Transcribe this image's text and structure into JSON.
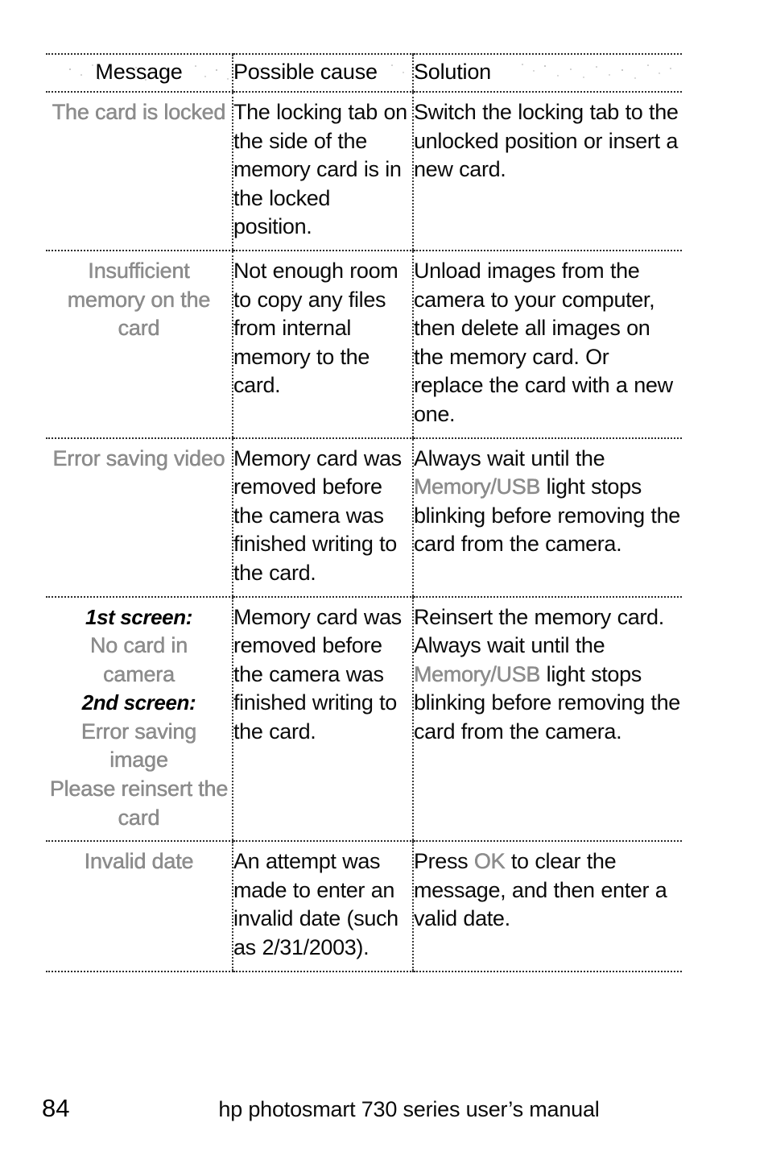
{
  "page": {
    "number": "84",
    "running_head": "hp photosmart 730 series user’s manual"
  },
  "table": {
    "headers": {
      "message": "Message",
      "possible_cause": "Possible cause",
      "solution": "Solution"
    },
    "rows": [
      {
        "message_lines": [
          "The card is locked"
        ],
        "possible_cause": "The locking tab on the side of the memory card is in the locked position.",
        "solution_pre": "Switch the locking tab to the unlocked position or insert a new card.",
        "solution_screen": "",
        "solution_post": ""
      },
      {
        "message_lines": [
          "Insufficient",
          "memory on the",
          "card"
        ],
        "possible_cause": "Not enough room to copy any files from internal memory to the card.",
        "solution_pre": "Unload images from the camera to your computer, then delete all images on the memory card. Or replace the card with a new one.",
        "solution_screen": "",
        "solution_post": ""
      },
      {
        "message_lines": [
          "Error saving video"
        ],
        "possible_cause": "Memory card was removed before the camera was finished writing to the card.",
        "solution_pre": "Always wait until the ",
        "solution_screen": "Memory/USB",
        "solution_post": " light stops blinking before removing the card from the camera."
      },
      {
        "message_lines": [],
        "message_blocks": [
          {
            "kind": "label",
            "text": "1st screen:"
          },
          {
            "kind": "screen",
            "text": "No card in"
          },
          {
            "kind": "screen",
            "text": "camera"
          },
          {
            "kind": "label",
            "text": "2nd screen:"
          },
          {
            "kind": "screen",
            "text": "Error saving"
          },
          {
            "kind": "screen",
            "text": "image"
          },
          {
            "kind": "screen",
            "text": "Please reinsert the"
          },
          {
            "kind": "screen",
            "text": "card"
          }
        ],
        "possible_cause": "Memory card was removed before the camera was finished writing to the card.",
        "solution_pre": "Reinsert the memory card. Always wait until the ",
        "solution_screen": "Memory/USB",
        "solution_post": " light stops blinking before removing the card from the camera."
      },
      {
        "message_lines": [
          "Invalid date"
        ],
        "possible_cause": "An attempt was made to enter an invalid date (such as 2/31/2003).",
        "solution_pre": "Press ",
        "solution_screen": "OK",
        "solution_post": " to clear the message, and then enter a valid date."
      }
    ]
  },
  "colors": {
    "rule": "#2b2b2b",
    "screen_text": "#8e8e8e",
    "body_text": "#0a0a0a"
  }
}
